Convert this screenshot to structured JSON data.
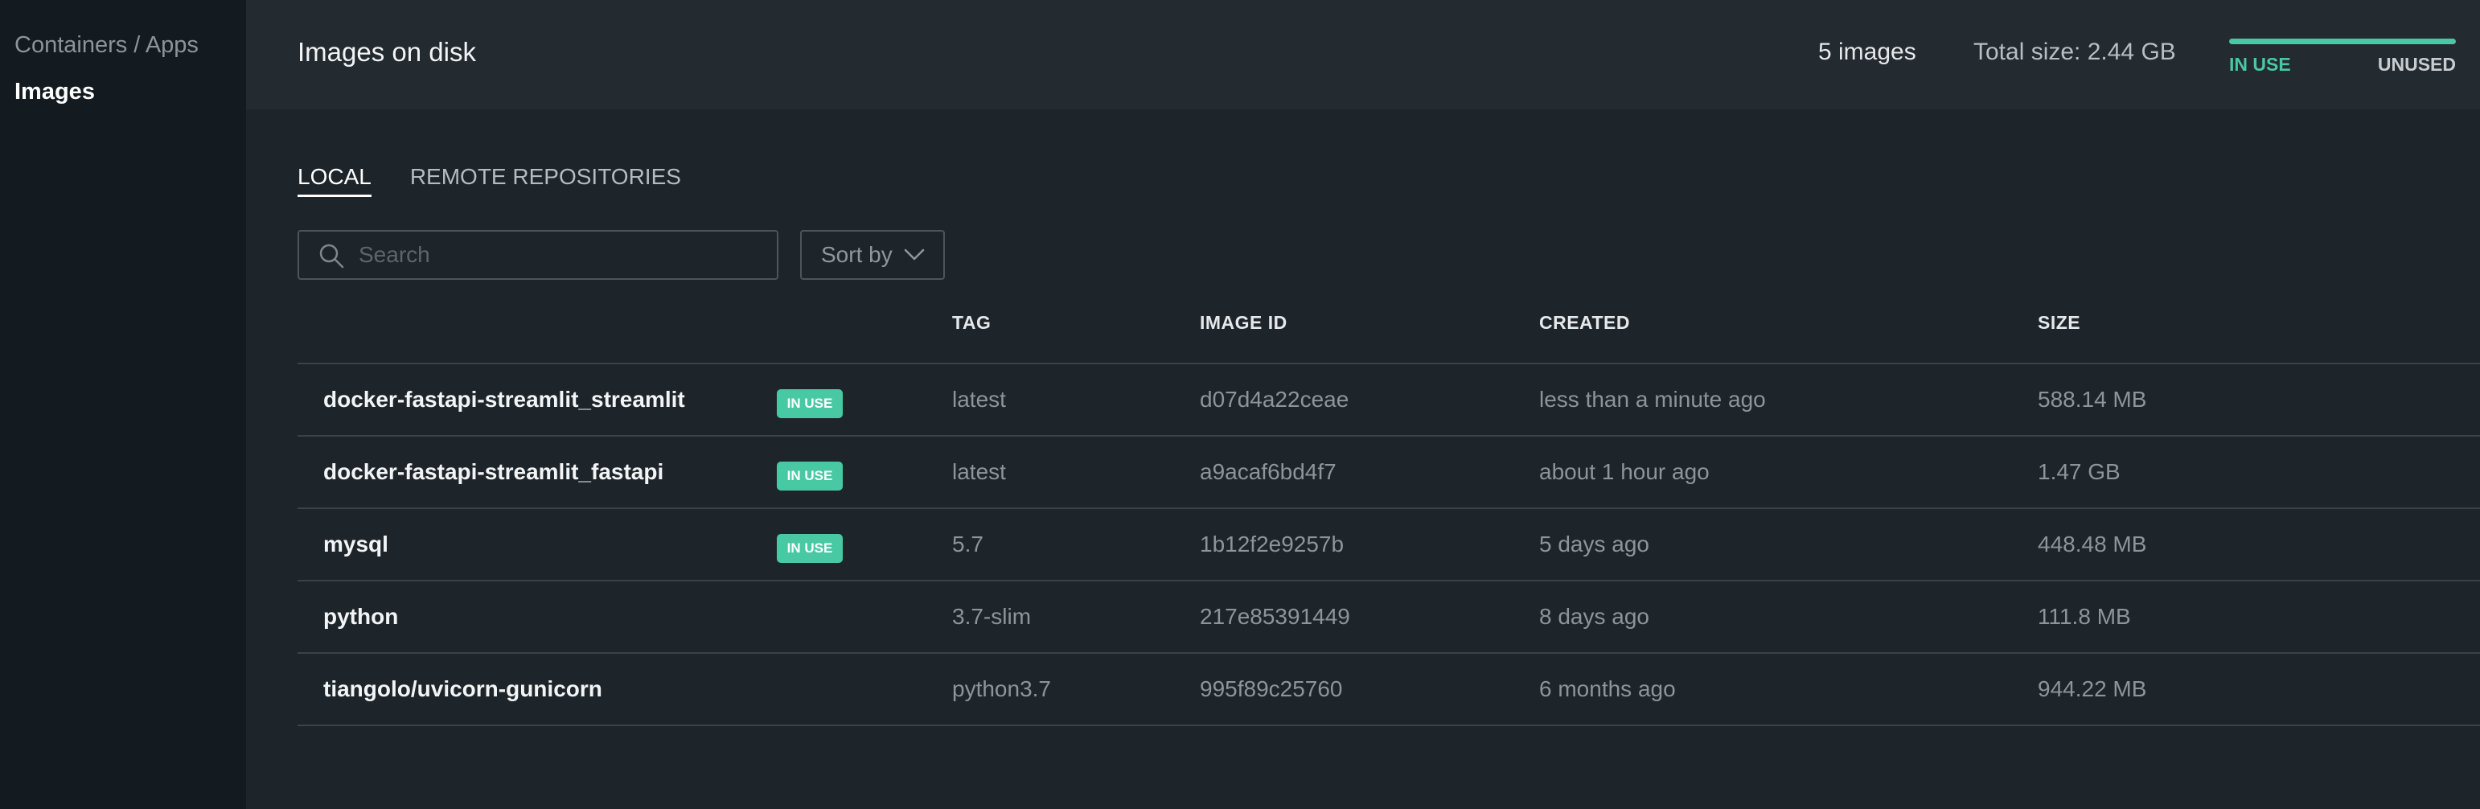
{
  "sidebar": {
    "breadcrumb": "Containers / Apps",
    "active_item": "Images"
  },
  "header": {
    "title": "Images on disk",
    "image_count": "5 images",
    "total_size": "Total size: 2.44 GB",
    "usage": {
      "in_use_label": "IN USE",
      "unused_label": "UNUSED",
      "in_use_fraction": 1.0
    }
  },
  "tabs": [
    {
      "label": "LOCAL",
      "active": true
    },
    {
      "label": "REMOTE REPOSITORIES",
      "active": false
    }
  ],
  "search": {
    "placeholder": "Search",
    "value": ""
  },
  "sort": {
    "label": "Sort by"
  },
  "table": {
    "columns": {
      "tag": "TAG",
      "image_id": "IMAGE ID",
      "created": "CREATED",
      "size": "SIZE"
    },
    "rows": [
      {
        "name": "docker-fastapi-streamlit_streamlit",
        "badge": "IN USE",
        "tag": "latest",
        "image_id": "d07d4a22ceae",
        "created": "less than a minute ago",
        "size": "588.14 MB"
      },
      {
        "name": "docker-fastapi-streamlit_fastapi",
        "badge": "IN USE",
        "tag": "latest",
        "image_id": "a9acaf6bd4f7",
        "created": "about 1 hour ago",
        "size": "1.47 GB"
      },
      {
        "name": "mysql",
        "badge": "IN USE",
        "tag": "5.7",
        "image_id": "1b12f2e9257b",
        "created": "5 days ago",
        "size": "448.48 MB"
      },
      {
        "name": "python",
        "badge": null,
        "tag": "3.7-slim",
        "image_id": "217e85391449",
        "created": "8 days ago",
        "size": "111.8 MB"
      },
      {
        "name": "tiangolo/uvicorn-gunicorn",
        "badge": null,
        "tag": "python3.7",
        "image_id": "995f89c25760",
        "created": "6 months ago",
        "size": "944.22 MB"
      }
    ]
  },
  "colors": {
    "accent": "#48c9a4",
    "background": "#1e252a",
    "sidebar": "#141b20",
    "header": "#232a30"
  }
}
